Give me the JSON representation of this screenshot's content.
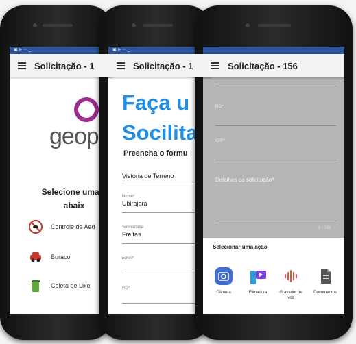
{
  "phones": [
    {
      "status": {
        "left": "▣ ⊳ ⋯ _",
        "right": "✱ ▮"
      },
      "appbar_title": "Solicitação - 1",
      "logo_text": "geop",
      "select_heading": "Selecione uma d abaix",
      "services": [
        {
          "label": "Controle de Aed",
          "icon": "mosquito-icon",
          "color": "#c0392b"
        },
        {
          "label": "Buraco",
          "icon": "car-icon",
          "color": "#c0392b"
        },
        {
          "label": "Coleta de Lixo",
          "icon": "trash-icon",
          "color": "#5fa93a"
        }
      ]
    },
    {
      "status": {
        "left": "▣ ⊳ ⋯ _",
        "right": "✱ ▮"
      },
      "appbar_title": "Solicitação - 1",
      "title_line1": "Faça u",
      "title_line2": "Socilita",
      "subtitle": "Preencha o formu",
      "fields": [
        {
          "label": "",
          "value": "Vistoria de Terreno"
        },
        {
          "label": "Nome*",
          "value": "Ubirajara"
        },
        {
          "label": "Sobrenome",
          "value": "Freitas"
        },
        {
          "label": "Email*",
          "value": ""
        },
        {
          "label": "RG*",
          "value": ""
        }
      ]
    },
    {
      "status": {
        "left": "",
        "right": ""
      },
      "appbar_title": "Solicitação - 156",
      "fields": [
        {
          "label": "RG*",
          "value": ""
        },
        {
          "label": "CPF*",
          "value": ""
        }
      ],
      "details_label": "Detalhes da solicitação*",
      "counter": "0 / 142",
      "sheet_title": "Selecionar uma ação",
      "actions": [
        {
          "label": "Câmera",
          "icon": "camera-icon",
          "color": "#3f6fd6"
        },
        {
          "label": "Filmadora",
          "icon": "video-icon",
          "color": "#7a3fe0"
        },
        {
          "label": "Gravador de voz",
          "icon": "microphone-wave-icon",
          "color": "#e8573c"
        },
        {
          "label": "Documentos",
          "icon": "document-icon",
          "color": "#555555"
        }
      ]
    }
  ]
}
